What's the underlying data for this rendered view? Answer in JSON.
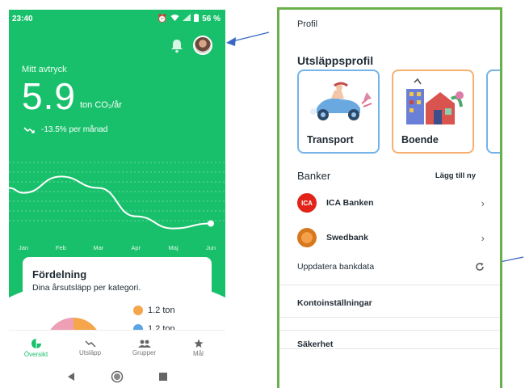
{
  "left": {
    "status": {
      "time": "23:40",
      "battery": "56 %"
    },
    "footprint": {
      "label": "Mitt avtryck",
      "value": "5.9",
      "unit": "ton CO₂/år",
      "trend": "-13.5% per månad"
    },
    "chart_data": {
      "type": "line",
      "categories": [
        "Jan",
        "Feb",
        "Mar",
        "Apr",
        "Maj",
        "Jun"
      ],
      "series": [
        {
          "values": [
            0.55,
            0.78,
            0.62,
            0.22,
            0.05,
            0.12
          ]
        }
      ],
      "xlabel": "",
      "ylabel": "",
      "grid": true
    },
    "card": {
      "title": "Fördelning",
      "subtitle": "Dina årsutsläpp per kategori.",
      "legend": [
        {
          "value": "1.2 ton",
          "icon": "home-icon",
          "color": "#f5a54a"
        },
        {
          "value": "1.2 ton",
          "icon": "leaf-icon",
          "color": "#5aa4e6"
        }
      ]
    },
    "nav": [
      {
        "label": "Översikt",
        "icon": "pie-chart-icon",
        "active": true
      },
      {
        "label": "Utsläpp",
        "icon": "trend-down-icon",
        "active": false
      },
      {
        "label": "Grupper",
        "icon": "group-icon",
        "active": false
      },
      {
        "label": "Mål",
        "icon": "star-icon",
        "active": false
      }
    ],
    "accent": "#19c06b"
  },
  "right": {
    "profile": "Profil",
    "emission_profile": "Utsläppsprofil",
    "tiles": [
      {
        "label": "Transport",
        "icon": "car-illustration"
      },
      {
        "label": "Boende",
        "icon": "house-illustration"
      }
    ],
    "banks_title": "Banker",
    "add_new": "Lägg till ny",
    "banks": [
      {
        "name": "ICA Banken",
        "logo_text": "ICA",
        "logo_color": "#e2231a"
      },
      {
        "name": "Swedbank",
        "logo_color": "#f08a24"
      }
    ],
    "update_bank": "Uppdatera bankdata",
    "account_settings": "Kontoinställningar",
    "security": "Säkerhet",
    "frame_color": "#6ab04c"
  },
  "annotation_color": "#3a66c4"
}
